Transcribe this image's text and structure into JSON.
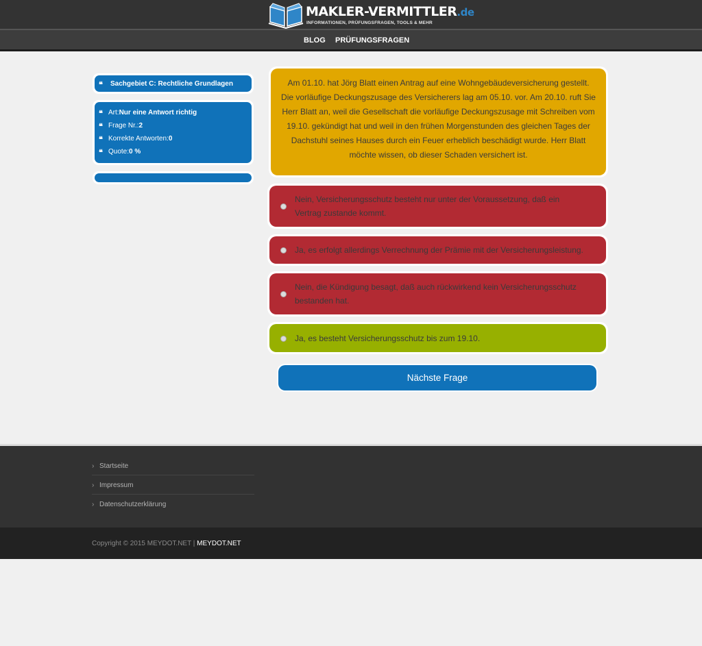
{
  "header": {
    "logo_main": "MAKLER-VERMITTLER",
    "logo_tld": ".de",
    "logo_tagline": "INFORMATIONEN, PRÜFUNGSFRAGEN, TOOLS & MEHR",
    "logo_colors": {
      "book": "#2f86c8",
      "text": "#ffffff"
    }
  },
  "nav": {
    "items": [
      {
        "label": "BLOG"
      },
      {
        "label": "PRÜFUNGSFRAGEN"
      }
    ]
  },
  "sidebar": {
    "category": {
      "icon": "quote-icon",
      "label": "Sachgebiet C: Rechtliche Grundlagen"
    },
    "stats": [
      {
        "icon": "quote-icon",
        "label": "Art: ",
        "value": "Nur eine Antwort richtig"
      },
      {
        "icon": "quote-icon",
        "label": "Frage Nr.: ",
        "value": "2"
      },
      {
        "icon": "quote-icon",
        "label": "Korrekte Antworten: ",
        "value": "0"
      },
      {
        "icon": "quote-icon",
        "label": "Quote: ",
        "value": "0 %"
      }
    ]
  },
  "question": {
    "text": "Am 01.10. hat Jörg Blatt einen Antrag auf eine Wohngebäudeversicherung gestellt. Die vorläufige Deckungszusage des Versicherers lag am 05.10. vor. Am 20.10. ruft Sie Herr Blatt an, weil die Gesellschaft die vorläufige Deckungszusage mit Schreiben vom 19.10. gekündigt hat und weil in den frühen Morgenstunden des gleichen Tages der Dachstuhl seines Hauses durch ein Feuer erheblich beschädigt wurde. Herr Blatt möchte wissen, ob dieser Schaden versichert ist."
  },
  "answers": [
    {
      "text": "Nein, Versicherungsschutz besteht nur unter der Voraussetzung, daß ein Vertrag zustande kommt.",
      "state": "wrong"
    },
    {
      "text": "Ja, es erfolgt allerdings Verrechnung der Prämie mit der Versicherungsleistung.",
      "state": "wrong"
    },
    {
      "text": "Nein, die Kündigung besagt, daß auch rückwirkend kein Versicherungsschutz bestanden hat.",
      "state": "wrong"
    },
    {
      "text": "Ja, es besteht Versicherungsschutz bis zum 19.10.",
      "state": "correct"
    }
  ],
  "next_button": {
    "label": "Nächste Frage"
  },
  "footer": {
    "links": [
      {
        "label": "Startseite"
      },
      {
        "label": "Impressum"
      },
      {
        "label": "Datenschutzerklärung"
      }
    ],
    "copyright": "Copyright © 2015 MEYDOT.NET | ",
    "brand": "MEYDOT.NET"
  },
  "colors": {
    "question_bg": "#e1a700",
    "wrong_bg": "#b22a33",
    "correct_bg": "#97b000",
    "accent_blue": "#1072b9",
    "header_bg": "#333333"
  }
}
